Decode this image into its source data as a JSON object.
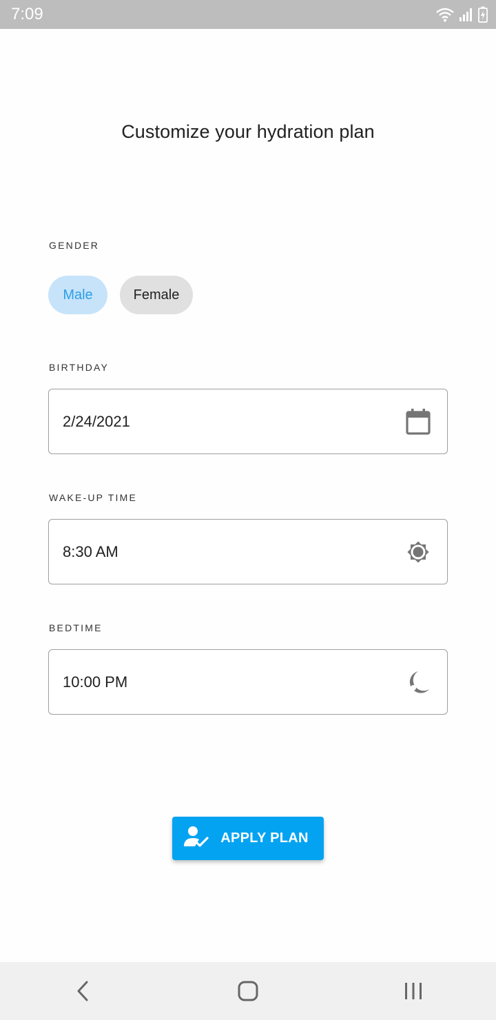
{
  "status_bar": {
    "time": "7:09"
  },
  "header": {
    "title": "Customize your hydration plan"
  },
  "gender": {
    "label": "GENDER",
    "options": [
      {
        "label": "Male",
        "selected": true
      },
      {
        "label": "Female",
        "selected": false
      }
    ]
  },
  "birthday": {
    "label": "BIRTHDAY",
    "value": "2/24/2021",
    "icon": "calendar-icon"
  },
  "wake_up": {
    "label": "WAKE-UP TIME",
    "value": "8:30 AM",
    "icon": "sun-icon"
  },
  "bedtime": {
    "label": "BEDTIME",
    "value": "10:00 PM",
    "icon": "moon-icon"
  },
  "apply_button": {
    "label": "APPLY PLAN",
    "icon": "user-check-icon"
  },
  "colors": {
    "accent": "#03a3f2",
    "chip_selected_bg": "#c6e3fa",
    "chip_selected_text": "#2c9ee6",
    "chip_unselected_bg": "#e0e0e0",
    "status_bar": "#bdbdbd",
    "nav_bar": "#f0f0f0"
  },
  "nav_bar": {
    "icons": [
      "back-icon",
      "home-icon",
      "recents-icon"
    ]
  }
}
